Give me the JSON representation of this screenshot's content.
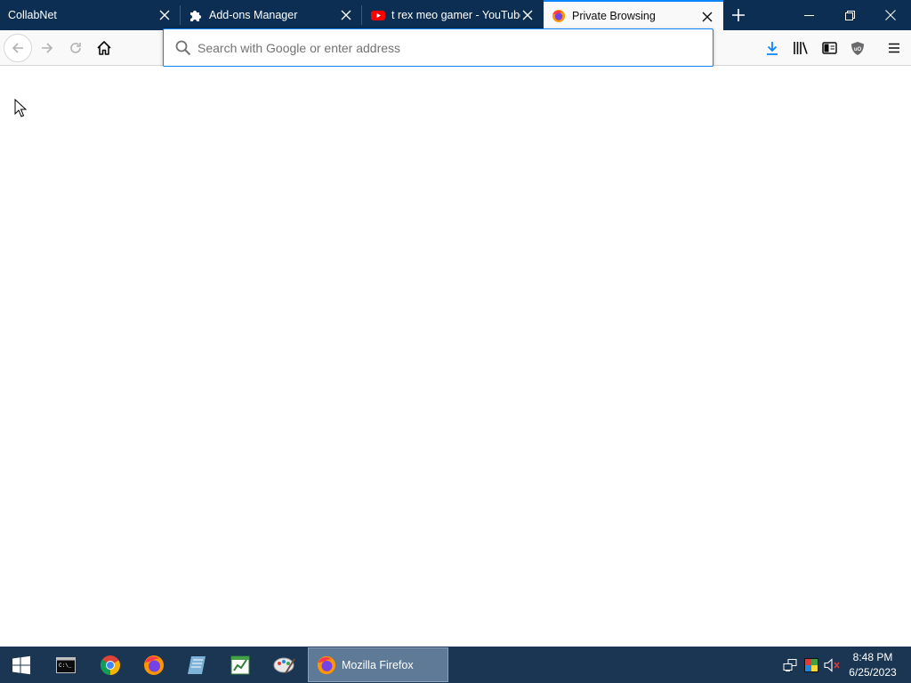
{
  "tabs": [
    {
      "title": "CollabNet",
      "icon": "none",
      "active": false
    },
    {
      "title": "Add-ons Manager",
      "icon": "puzzle-icon",
      "active": false
    },
    {
      "title": "t rex meo gamer - YouTube",
      "icon": "youtube-icon",
      "active": false
    },
    {
      "title": "Private Browsing",
      "icon": "firefox-icon",
      "active": true
    }
  ],
  "window_controls": [
    "minimize",
    "restore",
    "close"
  ],
  "urlbar": {
    "placeholder": "Search with Google or enter address",
    "value": ""
  },
  "toolbar_icons": [
    "download-icon",
    "library-icon",
    "sidebar-icon",
    "ublock-icon",
    "menu-icon"
  ],
  "taskbar": {
    "pinned": [
      "start-icon",
      "terminal-icon",
      "chrome-icon",
      "firefox-icon",
      "notepad-icon",
      "spreadsheet-icon",
      "paint-icon"
    ],
    "active_app": "Mozilla Firefox",
    "clock": {
      "time": "8:48 PM",
      "date": "6/25/2023"
    }
  },
  "colors": {
    "tabstrip": "#0b2e52",
    "accent": "#0a84ff",
    "taskbar": "#1b3652"
  }
}
